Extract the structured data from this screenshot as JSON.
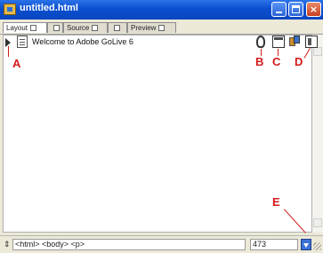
{
  "window": {
    "title": "untitled.html",
    "buttons": {
      "minimize": "minimize",
      "maximize": "maximize",
      "close": "×"
    }
  },
  "tabs": [
    {
      "label": "Layout",
      "active": true
    },
    {
      "label": "",
      "active": false
    },
    {
      "label": "Source",
      "active": false
    },
    {
      "label": "",
      "active": false
    },
    {
      "label": "Preview",
      "active": false
    }
  ],
  "content": {
    "welcome_text": "Welcome to Adobe GoLive 6"
  },
  "toolbar_icons": [
    "preview-icon",
    "page-properties-icon",
    "objects-icon",
    "document-icon"
  ],
  "callouts": {
    "a": "A",
    "b": "B",
    "c": "C",
    "d": "D",
    "e": "E"
  },
  "status": {
    "tag_path": "<html> <body> <p>",
    "size_value": "473"
  },
  "colors": {
    "callout": "#d41a1a",
    "titlebar": "#0a4fcf"
  }
}
